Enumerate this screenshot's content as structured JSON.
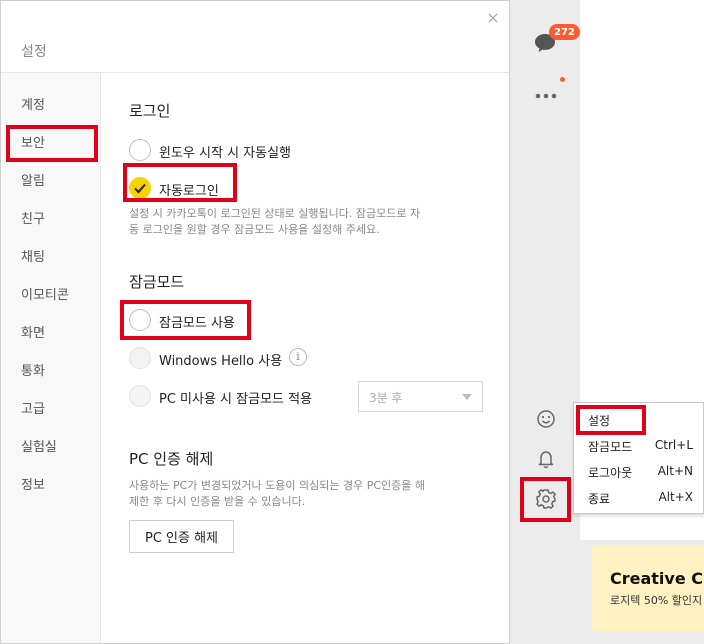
{
  "main_window": {
    "unread_count": "272",
    "context_menu": {
      "items": [
        {
          "label": "설정",
          "shortcut": ""
        },
        {
          "label": "잠금모드",
          "shortcut": "Ctrl+L"
        },
        {
          "label": "로그아웃",
          "shortcut": "Alt+N"
        },
        {
          "label": "종료",
          "shortcut": "Alt+X"
        }
      ]
    },
    "ad": {
      "title": "Creative Clo",
      "subtitle": "로지텍 50% 할인지"
    }
  },
  "dialog": {
    "title": "설정",
    "close_glyph": "×",
    "sidebar": {
      "items": [
        "계정",
        "보안",
        "알림",
        "친구",
        "채팅",
        "이모티콘",
        "화면",
        "통화",
        "고급",
        "실험실",
        "정보"
      ],
      "selected": "보안"
    },
    "login_section": {
      "title": "로그인",
      "auto_start_label": "윈도우 시작 시 자동실행",
      "auto_login_label": "자동로그인",
      "auto_login_checked": true,
      "description_line1": "설정 시 카카오톡이 로그인된 상태로 실행됩니다. 잠금모드로 자",
      "description_line2": "동 로그인을 원할 경우 잠금모드 사용을 설정해 주세요."
    },
    "lock_section": {
      "title": "잠금모드",
      "use_lock_label": "잠금모드 사용",
      "windows_hello_label": "Windows Hello 사용",
      "info_glyph": "i",
      "idle_lock_label": "PC 미사용 시 잠금모드 적용",
      "idle_time_value": "3분 후"
    },
    "pc_auth_section": {
      "title": "PC 인증 해제",
      "description_line1": "사용하는 PC가 변경되었거나 도용이 의심되는 경우 PC인증을 해",
      "description_line2": "제한 후 다시 인증을 받을 수 있습니다.",
      "button_label": "PC 인증 해제"
    }
  },
  "colors": {
    "highlight_red": "#e0001b",
    "kakao_yellow": "#f7d200",
    "badge_orange": "#ff5a30"
  }
}
